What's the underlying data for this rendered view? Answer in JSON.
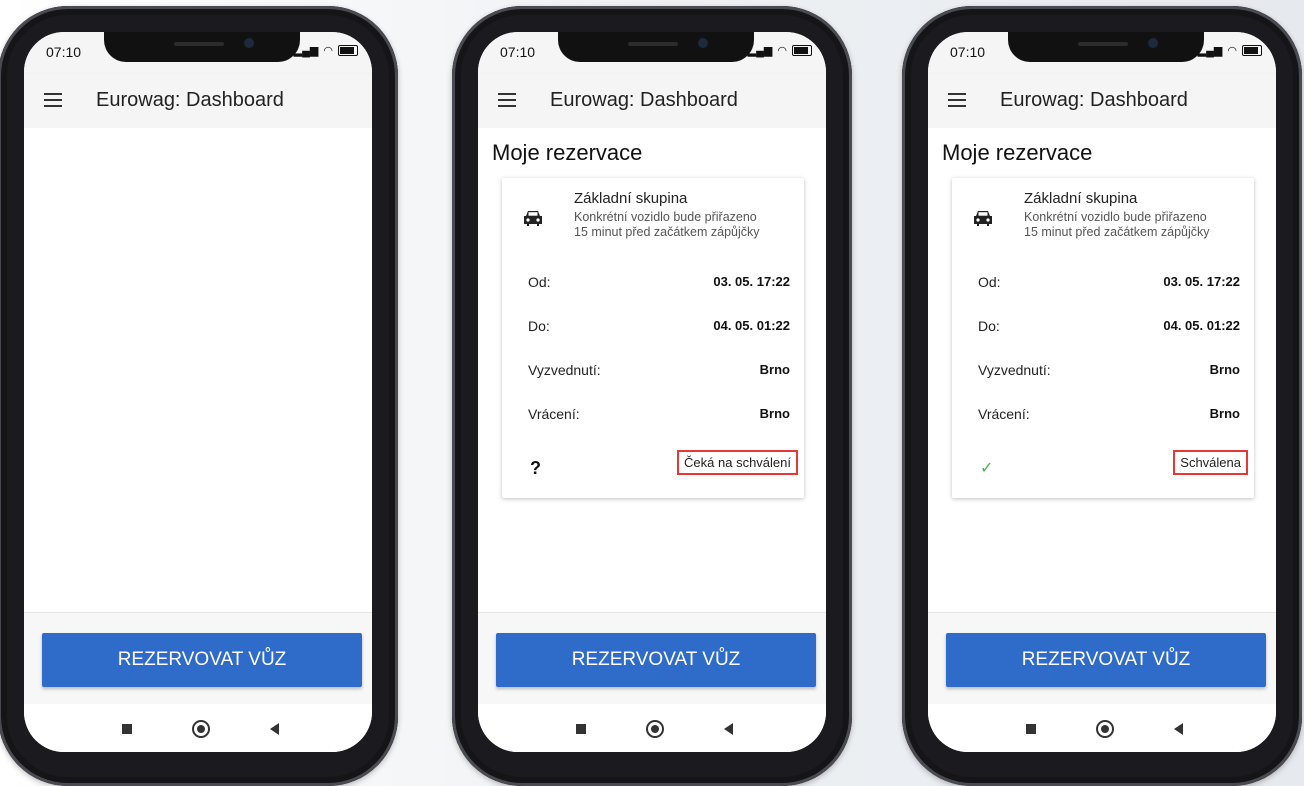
{
  "screens": [
    {
      "status_time": "07:10",
      "app_title": "Eurowag: Dashboard",
      "reserve_button": "REZERVOVAT VŮZ"
    },
    {
      "status_time": "07:10",
      "app_title": "Eurowag: Dashboard",
      "section_title": "Moje rezervace",
      "card": {
        "group": "Základní skupina",
        "note_line1": "Konkrétní vozidlo bude přiřazeno",
        "note_line2": "15 minut před začátkem zápůjčky",
        "from_label": "Od:",
        "from_value": "03. 05. 17:22",
        "to_label": "Do:",
        "to_value": "04. 05. 01:22",
        "pickup_label": "Vyzvednutí:",
        "pickup_value": "Brno",
        "return_label": "Vrácení:",
        "return_value": "Brno",
        "status_symbol": "?",
        "status_text": "Čeká na schválení"
      },
      "reserve_button": "REZERVOVAT VŮZ"
    },
    {
      "status_time": "07:10",
      "app_title": "Eurowag: Dashboard",
      "section_title": "Moje rezervace",
      "card": {
        "group": "Základní skupina",
        "note_line1": "Konkrétní vozidlo bude přiřazeno",
        "note_line2": "15 minut před začátkem zápůjčky",
        "from_label": "Od:",
        "from_value": "03. 05. 17:22",
        "to_label": "Do:",
        "to_value": "04. 05. 01:22",
        "pickup_label": "Vyzvednutí:",
        "pickup_value": "Brno",
        "return_label": "Vrácení:",
        "return_value": "Brno",
        "status_symbol": "✓",
        "status_text": "Schválena"
      },
      "reserve_button": "REZERVOVAT VŮZ"
    }
  ],
  "colors": {
    "primary": "#2f6bc9",
    "highlight_border": "#e53935",
    "approved_check": "#4caf50"
  },
  "icons": [
    "menu-icon",
    "car-icon",
    "question-icon",
    "check-icon",
    "signal-icon",
    "wifi-icon",
    "battery-icon",
    "nav-recents-icon",
    "nav-home-icon",
    "nav-back-icon"
  ]
}
